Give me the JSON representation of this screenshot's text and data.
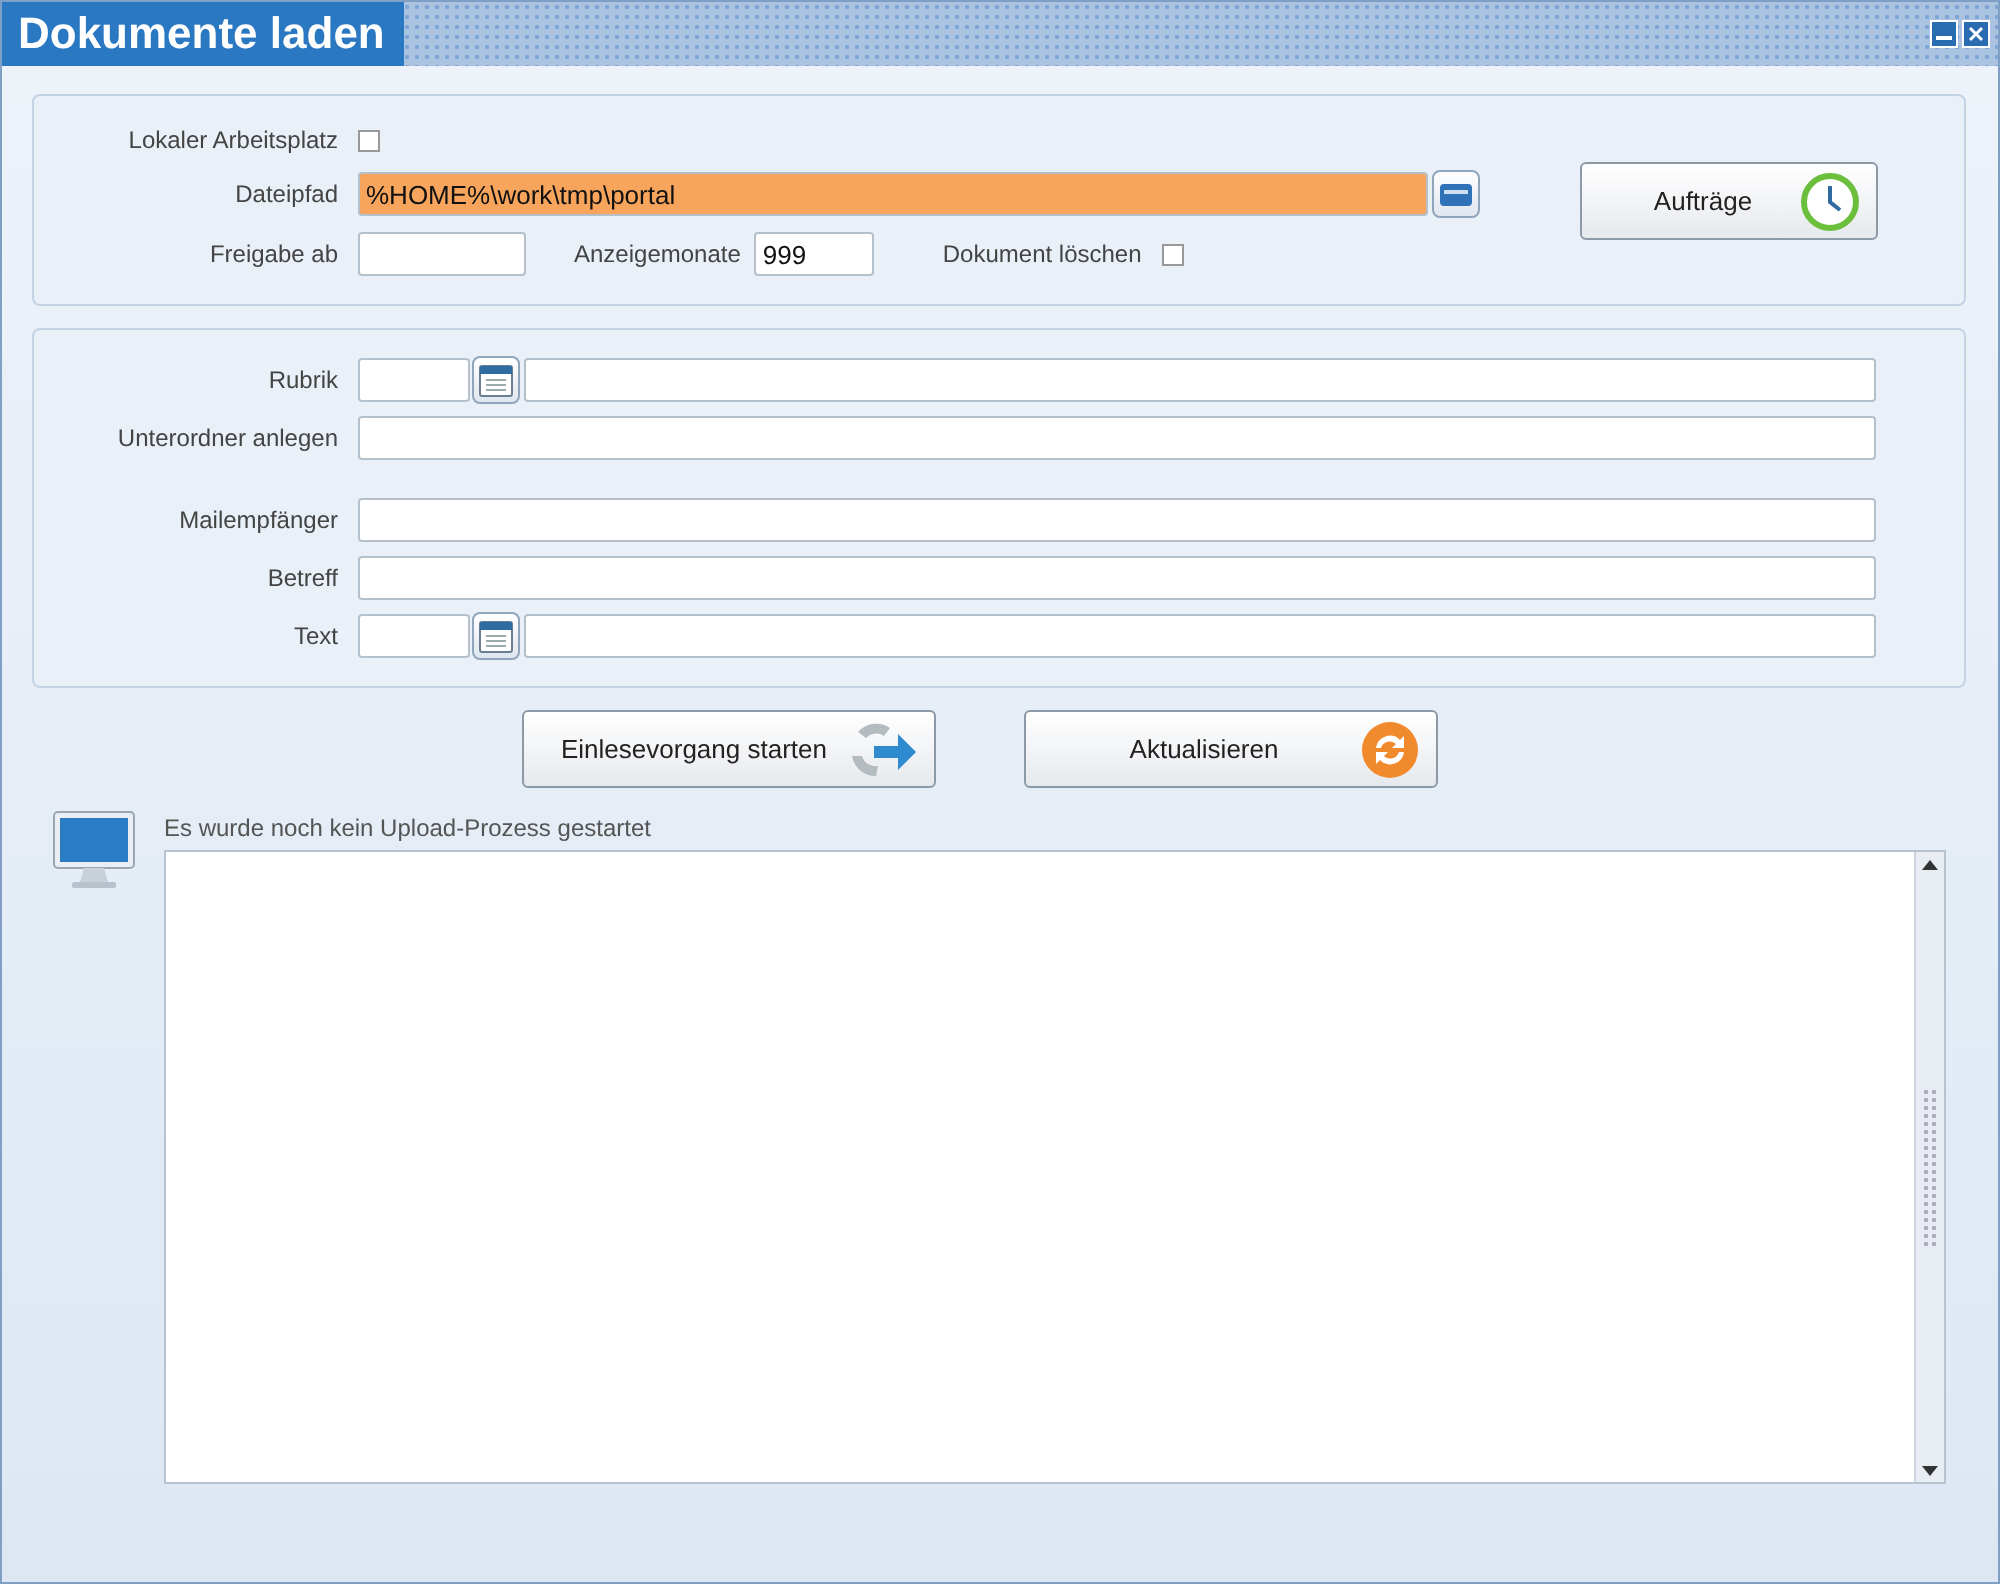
{
  "window": {
    "title": "Dokumente laden"
  },
  "source": {
    "local_workplace": {
      "label": "Lokaler Arbeitsplatz",
      "checked": false
    },
    "file_path": {
      "label": "Dateipfad",
      "value": "%HOME%\\work\\tmp\\portal",
      "focused": true
    },
    "release_from": {
      "label": "Freigabe ab"
    },
    "display_months": {
      "label": "Anzeigemonate",
      "value": "999"
    },
    "delete_document": {
      "label": "Dokument löschen",
      "checked": false
    },
    "orders_button": "Aufträge"
  },
  "fields": [
    [
      {
        "kind": "lookup",
        "label": "Rubrik"
      },
      {
        "kind": "text",
        "label": "Unterordner anlegen"
      }
    ],
    [
      {
        "kind": "text",
        "label": "Mailempfänger"
      },
      {
        "kind": "text",
        "label": "Betreff"
      },
      {
        "kind": "lookup",
        "label": "Text"
      }
    ]
  ],
  "actions": [
    {
      "kind": "import",
      "label": "Einlesevorgang starten"
    },
    {
      "kind": "refresh",
      "label": "Aktualisieren"
    }
  ],
  "log": {
    "status": "Es wurde noch kein Upload-Prozess gestartet"
  }
}
